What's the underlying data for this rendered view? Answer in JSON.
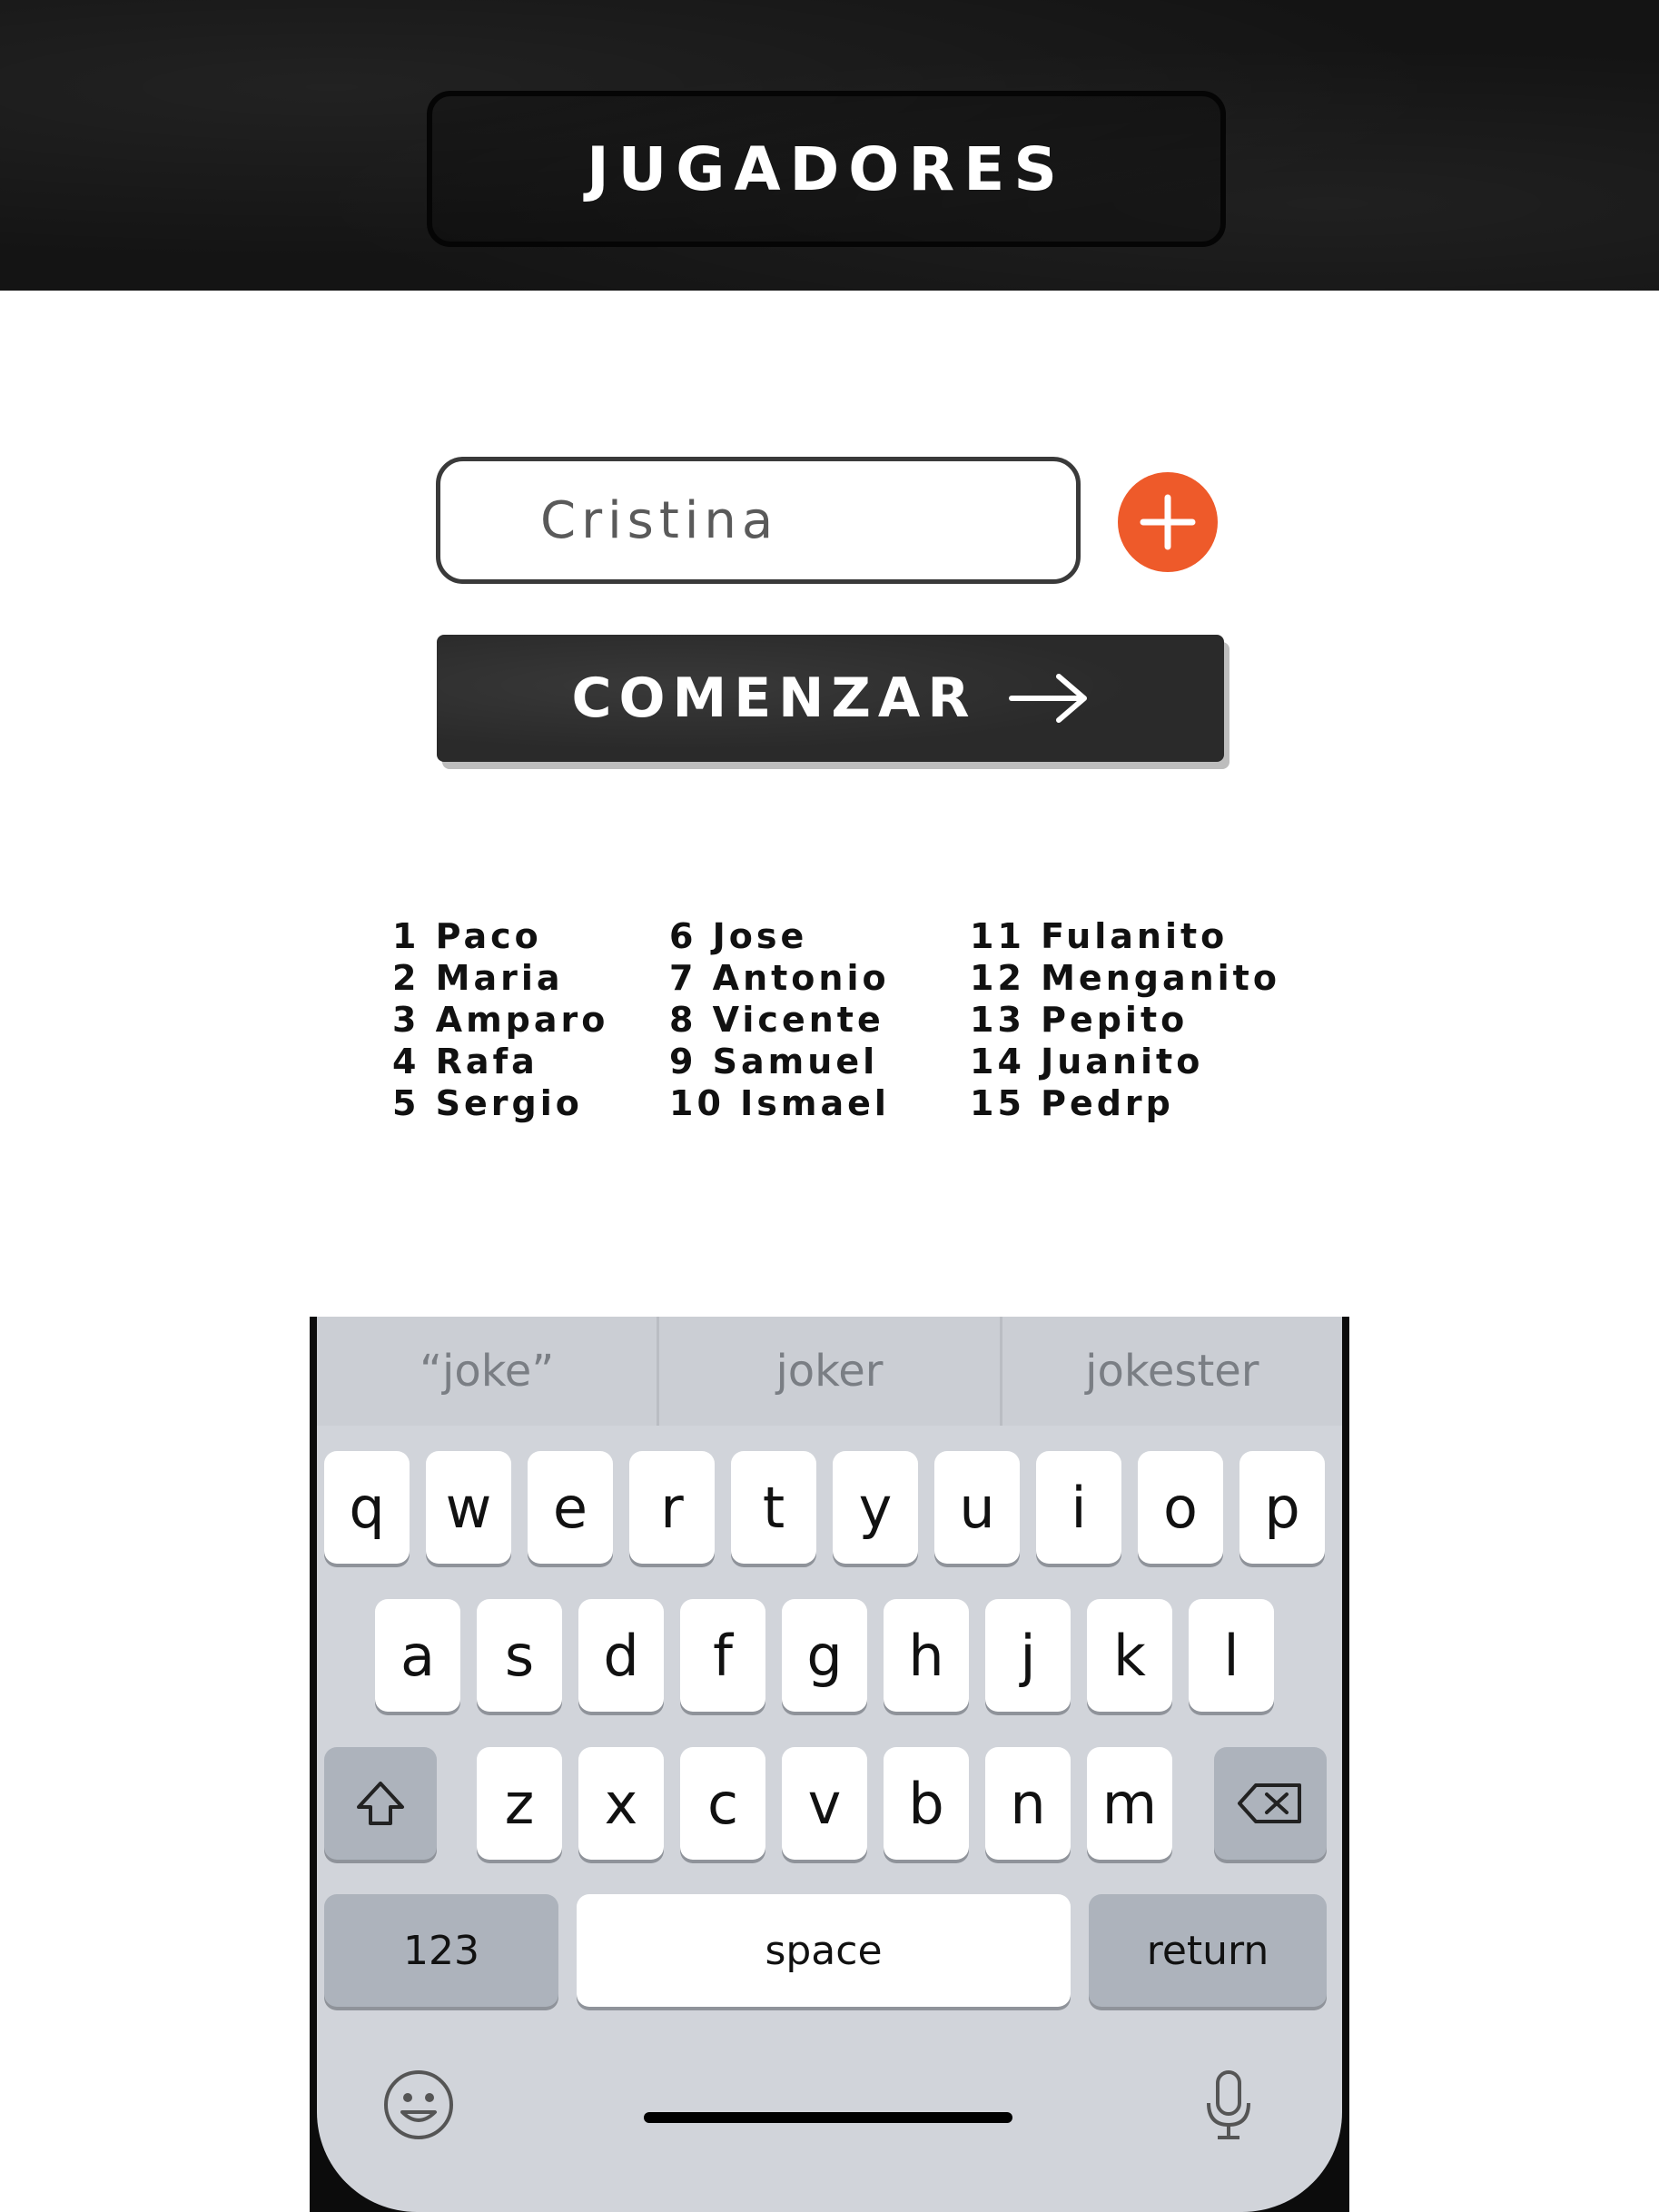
{
  "header": {
    "title": "JUGADORES"
  },
  "form": {
    "name_value": "Cristina",
    "add_button_icon": "plus-icon",
    "start_label": "COMENZAR",
    "start_icon": "arrow-right-icon",
    "accent_color": "#ee5a2a"
  },
  "players": {
    "columns": [
      [
        "1 Paco",
        "2 Maria",
        "3 Amparo",
        "4 Rafa",
        "5 Sergio"
      ],
      [
        "6 Jose",
        "7 Antonio",
        "8 Vicente",
        "9 Samuel",
        "10 Ismael"
      ],
      [
        "11 Fulanito",
        "12 Menganito",
        "13 Pepito",
        "14 Juanito",
        "15 Pedrp"
      ]
    ]
  },
  "keyboard": {
    "suggestions": [
      "“joke”",
      "joker",
      "jokester"
    ],
    "row1": [
      "q",
      "w",
      "e",
      "r",
      "t",
      "y",
      "u",
      "i",
      "o",
      "p"
    ],
    "row2": [
      "a",
      "s",
      "d",
      "f",
      "g",
      "h",
      "j",
      "k",
      "l"
    ],
    "row3": [
      "z",
      "x",
      "c",
      "v",
      "b",
      "n",
      "m"
    ],
    "shift_icon": "shift-icon",
    "delete_icon": "delete-icon",
    "numbers_label": "123",
    "space_label": "space",
    "return_label": "return",
    "emoji_icon": "emoji-icon",
    "mic_icon": "microphone-icon"
  }
}
